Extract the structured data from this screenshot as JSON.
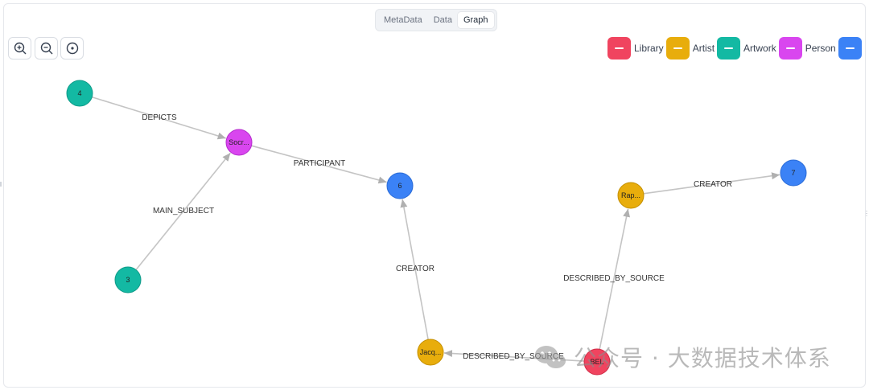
{
  "tabs": [
    {
      "label": "MetaData",
      "active": false
    },
    {
      "label": "Data",
      "active": false
    },
    {
      "label": "Graph",
      "active": true
    }
  ],
  "zoom_controls": [
    {
      "icon": "zoom-in-icon"
    },
    {
      "icon": "zoom-out-icon"
    },
    {
      "icon": "fit-center-icon"
    }
  ],
  "legend": [
    {
      "label": "Library",
      "color": "#f0445f"
    },
    {
      "label": "Artist",
      "color": "#e8ad0c"
    },
    {
      "label": "Artwork",
      "color": "#13b9a3"
    },
    {
      "label": "Person",
      "color": "#d946ef"
    },
    {
      "label": "",
      "color": "#3b82f6"
    }
  ],
  "graph": {
    "nodes": [
      {
        "id": "n4",
        "label": "4",
        "type": "Artwork"
      },
      {
        "id": "nSoc",
        "label": "Socr...",
        "type": "Person"
      },
      {
        "id": "n3",
        "label": "3",
        "type": "Artwork"
      },
      {
        "id": "n6",
        "label": "6",
        "type": "Other"
      },
      {
        "id": "nRap",
        "label": "Rap...",
        "type": "Artist"
      },
      {
        "id": "n7",
        "label": "7",
        "type": "Other"
      },
      {
        "id": "nJac",
        "label": "Jacq...",
        "type": "Artist"
      },
      {
        "id": "nBel",
        "label": "BEL",
        "type": "Library"
      }
    ],
    "edges": [
      {
        "from": "n4",
        "to": "nSoc",
        "label": "DEPICTS"
      },
      {
        "from": "n3",
        "to": "nSoc",
        "label": "MAIN_SUBJECT"
      },
      {
        "from": "nSoc",
        "to": "n6",
        "label": "PARTICIPANT"
      },
      {
        "from": "nJac",
        "to": "n6",
        "label": "CREATOR"
      },
      {
        "from": "nRap",
        "to": "n7",
        "label": "CREATOR"
      },
      {
        "from": "nBel",
        "to": "nRap",
        "label": "DESCRIBED_BY_SOURCE"
      },
      {
        "from": "nBel",
        "to": "nJac",
        "label": "DESCRIBED_BY_SOURCE"
      }
    ]
  },
  "watermark": {
    "text": "公众号 · 大数据技术体系",
    "icon": "wechat-icon"
  }
}
